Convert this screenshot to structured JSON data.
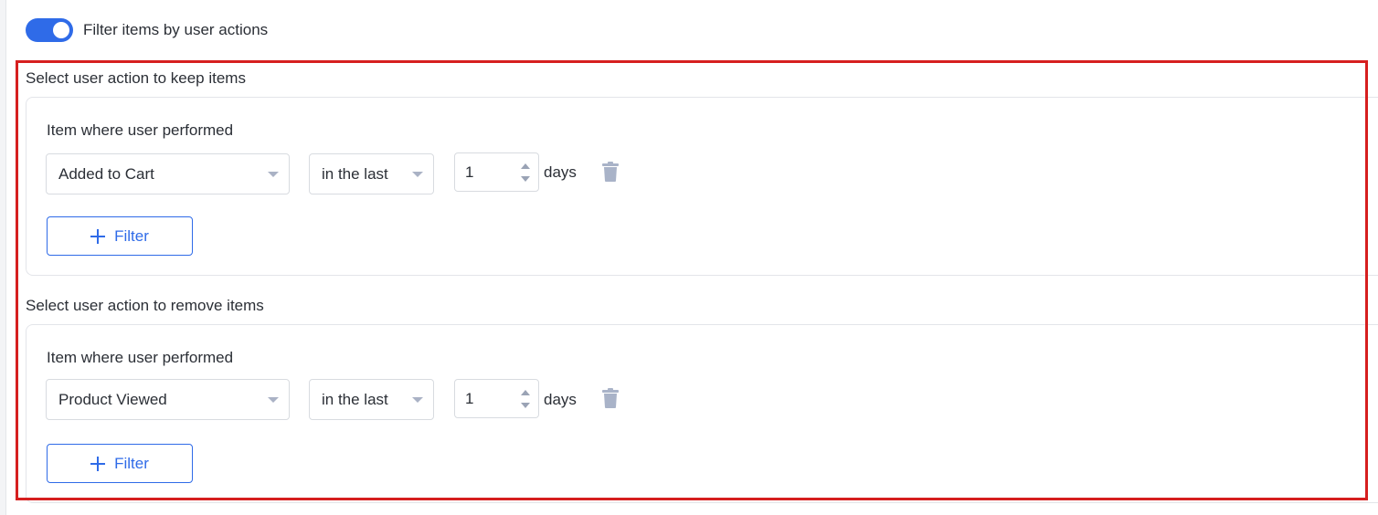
{
  "toggle": {
    "label": "Filter items by user actions",
    "state": "on",
    "accent_color": "#2f6be8"
  },
  "keep_section": {
    "title": "Select user action to keep items",
    "condition": {
      "label": "Item where user performed",
      "action_value": "Added to Cart",
      "timeframe_value": "in the last",
      "amount_value": "1",
      "unit": "days",
      "delete_icon": "trash-icon"
    },
    "add_filter_label": "Filter"
  },
  "remove_section": {
    "title": "Select user action to remove items",
    "condition": {
      "label": "Item where user performed",
      "action_value": "Product Viewed",
      "timeframe_value": "in the last",
      "amount_value": "1",
      "unit": "days",
      "delete_icon": "trash-icon"
    },
    "add_filter_label": "Filter"
  },
  "highlight_color": "#d61f1f"
}
